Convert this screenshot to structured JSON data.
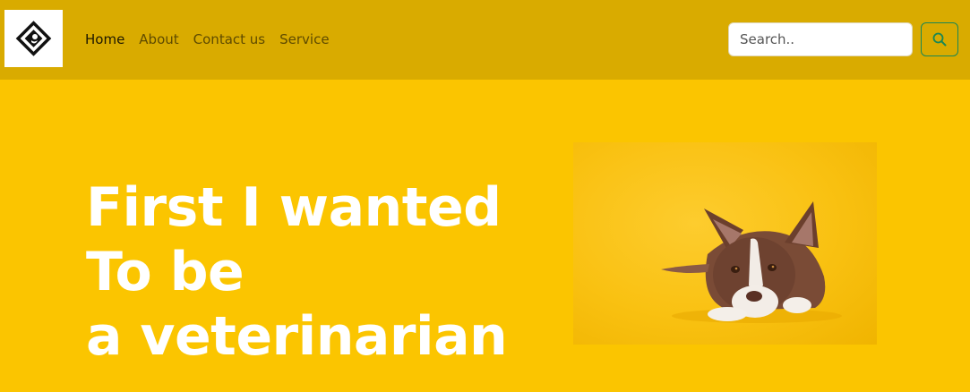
{
  "nav": {
    "logo_icon": "dog-diamond-logo-icon",
    "links": [
      {
        "label": "Home",
        "active": true
      },
      {
        "label": "About",
        "active": false
      },
      {
        "label": "Contact us",
        "active": false
      },
      {
        "label": "Service",
        "active": false
      }
    ],
    "search": {
      "placeholder": "Search..",
      "value": ""
    },
    "search_button_icon": "search-icon"
  },
  "hero": {
    "heading_lines": [
      "First I wanted",
      "To be",
      "a veterinarian"
    ],
    "image_icon": "dog-photo"
  },
  "colors": {
    "page_background": "#fbc500",
    "navbar_background": "#d9ab00",
    "search_button_border": "#198754"
  }
}
